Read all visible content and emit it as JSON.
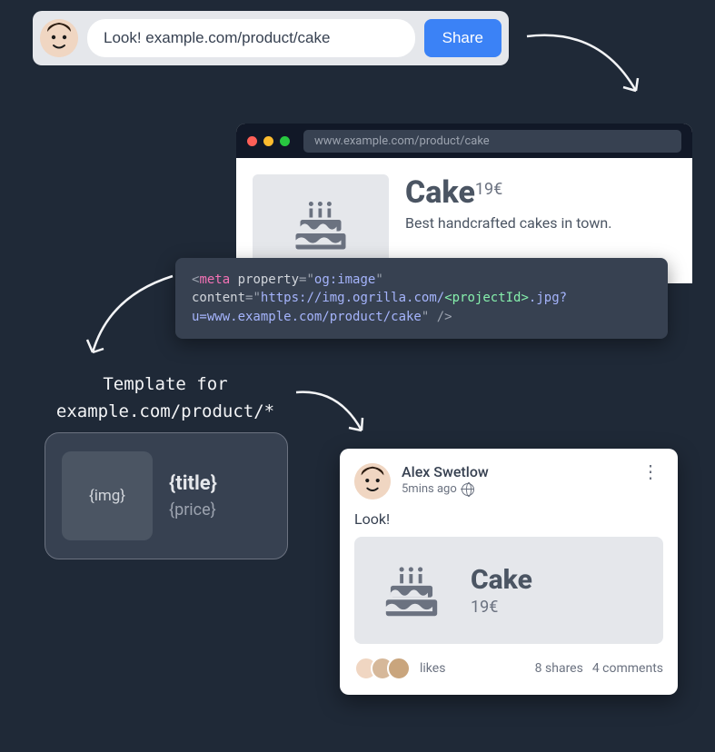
{
  "share_bar": {
    "input_value": "Look! example.com/product/cake",
    "button_label": "Share"
  },
  "browser": {
    "url": "www.example.com/product/cake",
    "title": "Cake",
    "price": "19€",
    "description": "Best handcrafted cakes in town."
  },
  "code": {
    "tag": "meta",
    "attr1": "property",
    "val1": "og:image",
    "attr2": "content",
    "val2a": "https://img.ogrilla.com/",
    "val2b": "<projectId>",
    "val2c": ".jpg?u=www.example.com/product/cake"
  },
  "template": {
    "label_line1": "Template for",
    "label_line2": "example.com/product/*",
    "img_placeholder": "{img}",
    "title_placeholder": "{title}",
    "price_placeholder": "{price}"
  },
  "social": {
    "author": "Alex Swetlow",
    "time": "5mins ago",
    "body": "Look!",
    "preview_title": "Cake",
    "preview_price": "19€",
    "likes_label": "likes",
    "shares_label": "8 shares",
    "comments_label": "4 comments"
  }
}
